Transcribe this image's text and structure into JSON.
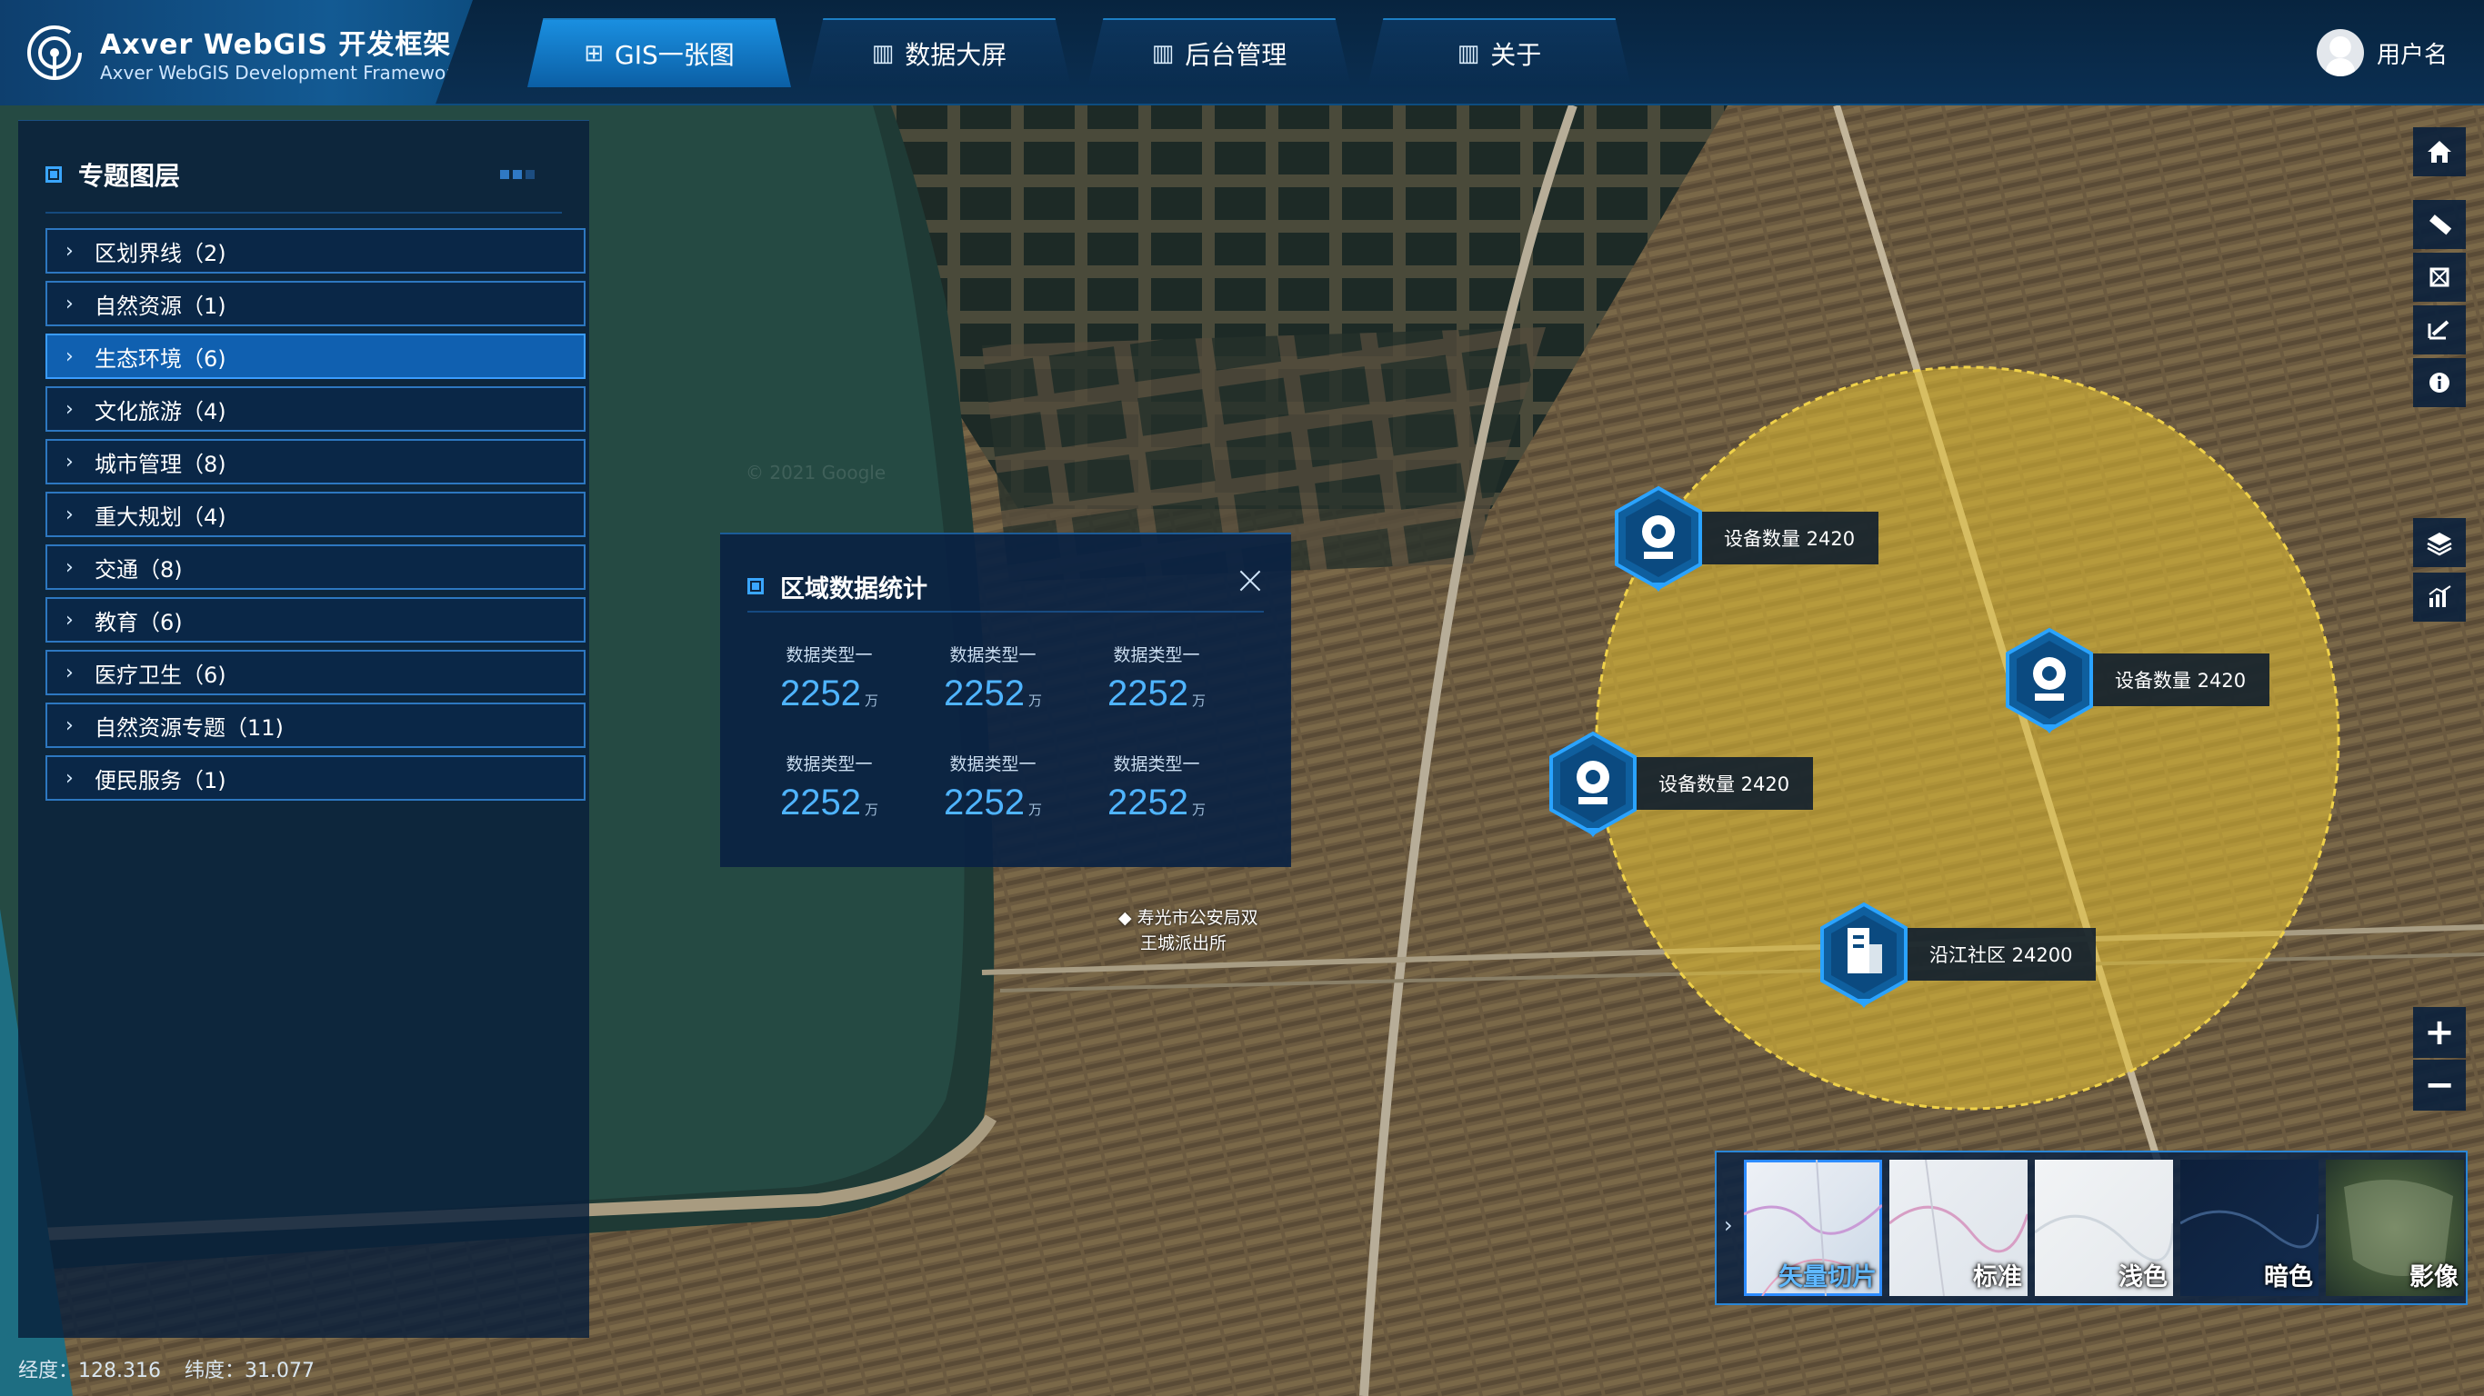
{
  "brand": {
    "title": "Axver WebGIS 开发框架",
    "subtitle": "Axver WebGIS Development Framework",
    "logo_icon": "target-icon"
  },
  "nav": {
    "tabs": [
      {
        "icon": "grid-icon",
        "label": "GIS一张图",
        "active": true
      },
      {
        "icon": "chart-icon",
        "label": "数据大屏",
        "active": false
      },
      {
        "icon": "chart-icon",
        "label": "后台管理",
        "active": false
      },
      {
        "icon": "chart-icon",
        "label": "关于",
        "active": false
      }
    ]
  },
  "user": {
    "name": "用户名"
  },
  "layers_panel": {
    "title": "专题图层",
    "items": [
      {
        "label": "区划界线（2)",
        "active": false
      },
      {
        "label": "自然资源（1)",
        "active": false
      },
      {
        "label": "生态环境（6)",
        "active": true
      },
      {
        "label": "文化旅游（4)",
        "active": false
      },
      {
        "label": "城市管理（8)",
        "active": false
      },
      {
        "label": "重大规划（4)",
        "active": false
      },
      {
        "label": "交通（8)",
        "active": false
      },
      {
        "label": "教育（6)",
        "active": false
      },
      {
        "label": "医疗卫生（6)",
        "active": false
      },
      {
        "label": "自然资源专题（11)",
        "active": false
      },
      {
        "label": "便民服务（1)",
        "active": false
      }
    ]
  },
  "stats_popup": {
    "title": "区域数据统计",
    "cells": [
      {
        "label": "数据类型一",
        "value": "2252",
        "unit": "万"
      },
      {
        "label": "数据类型一",
        "value": "2252",
        "unit": "万"
      },
      {
        "label": "数据类型一",
        "value": "2252",
        "unit": "万"
      },
      {
        "label": "数据类型一",
        "value": "2252",
        "unit": "万"
      },
      {
        "label": "数据类型一",
        "value": "2252",
        "unit": "万"
      },
      {
        "label": "数据类型一",
        "value": "2252",
        "unit": "万"
      }
    ]
  },
  "map": {
    "place_label_1": "寿光市公安局双",
    "place_label_2": "王城派出所",
    "watermark": "© 2021 Google",
    "markers": [
      {
        "icon": "camera-icon",
        "label": "设备数量 2420"
      },
      {
        "icon": "camera-icon",
        "label": "设备数量 2420"
      },
      {
        "icon": "camera-icon",
        "label": "设备数量 2420"
      },
      {
        "icon": "building-icon",
        "label": "沿江社区 24200"
      }
    ],
    "overlay_color": "#e8c233"
  },
  "toolbar": {
    "tools": [
      "home-icon",
      "ruler-icon",
      "area-measure-icon",
      "draw-icon",
      "info-icon",
      "layers-icon",
      "chart-icon"
    ],
    "zoom_in": "+",
    "zoom_out": "−"
  },
  "basemaps": {
    "items": [
      {
        "label": "矢量切片",
        "active": true
      },
      {
        "label": "标准",
        "active": false
      },
      {
        "label": "浅色",
        "active": false
      },
      {
        "label": "暗色",
        "active": false
      },
      {
        "label": "影像",
        "active": false
      }
    ]
  },
  "coords": {
    "lng_label": "经度：",
    "lng": "128.316",
    "lat_label": "纬度：",
    "lat": "31.077"
  }
}
